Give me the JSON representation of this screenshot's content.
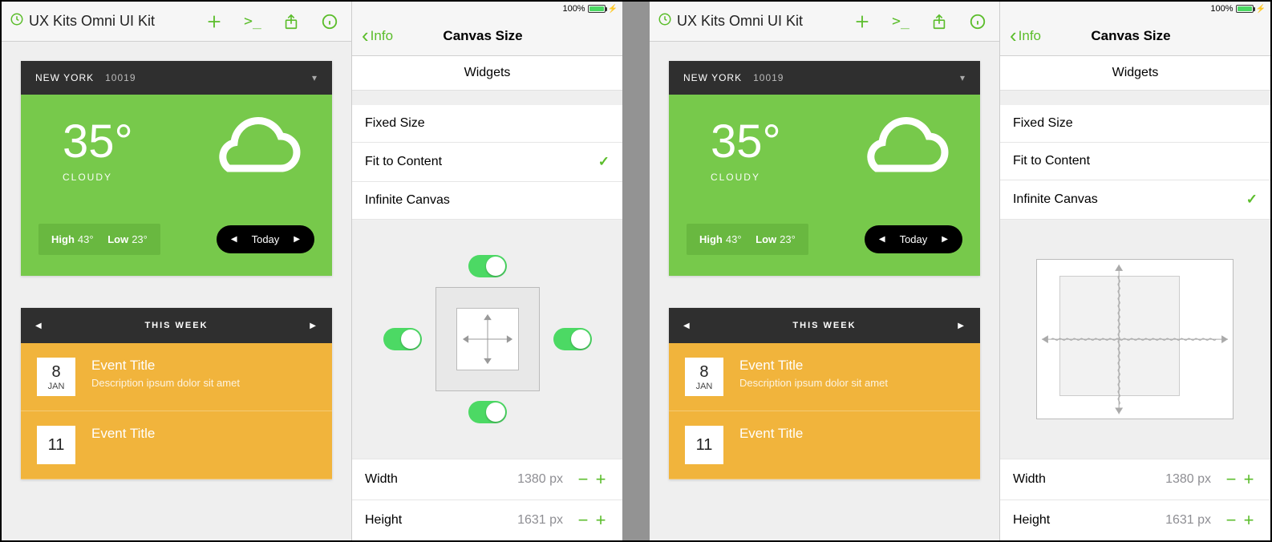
{
  "status": {
    "battery_pct": "100%"
  },
  "toolbar": {
    "doc_title": "UX Kits Omni UI Kit"
  },
  "backbar": {
    "back_label": "Info",
    "title": "Canvas Size"
  },
  "section": {
    "widgets": "Widgets"
  },
  "options": {
    "fixed": "Fixed Size",
    "fit": "Fit to Content",
    "infinite": "Infinite Canvas"
  },
  "dims": {
    "width_label": "Width",
    "height_label": "Height",
    "width_value": "1380 px",
    "height_value": "1631 px"
  },
  "weather": {
    "city": "NEW YORK",
    "zip": "10019",
    "temp": "35°",
    "cond": "CLOUDY",
    "high_label": "High",
    "high_val": "43°",
    "low_label": "Low",
    "low_val": "23°",
    "today": "Today"
  },
  "events": {
    "header": "THIS WEEK",
    "items": [
      {
        "day": "8",
        "mon": "JAN",
        "title": "Event Title",
        "desc": "Description ipsum dolor sit amet"
      },
      {
        "day": "11",
        "mon": "",
        "title": "Event Title",
        "desc": ""
      }
    ]
  },
  "panes": {
    "left_selected": "fit",
    "right_selected": "infinite"
  }
}
